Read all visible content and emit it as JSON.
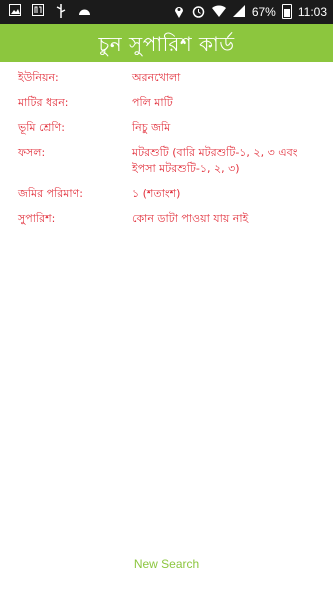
{
  "status_bar": {
    "icons_left": [
      "image-icon",
      "sim-icon",
      "usb-icon",
      "android-icon"
    ],
    "icons_right": [
      "location-icon",
      "alarm-icon",
      "wifi-icon",
      "signal-icon",
      "battery-icon"
    ],
    "battery": "67%",
    "time": "11:03"
  },
  "header": {
    "title": "চুন সুপারিশ কার্ড",
    "color": "#8cc63e"
  },
  "details": [
    {
      "label": "ইউনিয়ন:",
      "value": "অরনখোলা"
    },
    {
      "label": "মাটির ধরন:",
      "value": "পলি মাটি"
    },
    {
      "label": "ভূমি শ্রেণি:",
      "value": "নিচু জমি"
    },
    {
      "label": "ফসল:",
      "value": "মটরশুটি (বারি মটরশুটি-১, ২, ৩ এবং ইপসা মটরশুটি-১, ২, ৩)"
    },
    {
      "label": "জমির পরিমাণ:",
      "value": "১ (শতাংশ)"
    },
    {
      "label": "সুপারিশ:",
      "value": "কোন ডাটা পাওয়া যায় নাই"
    }
  ],
  "new_search_label": "New Search",
  "text_color": "#e2303c"
}
